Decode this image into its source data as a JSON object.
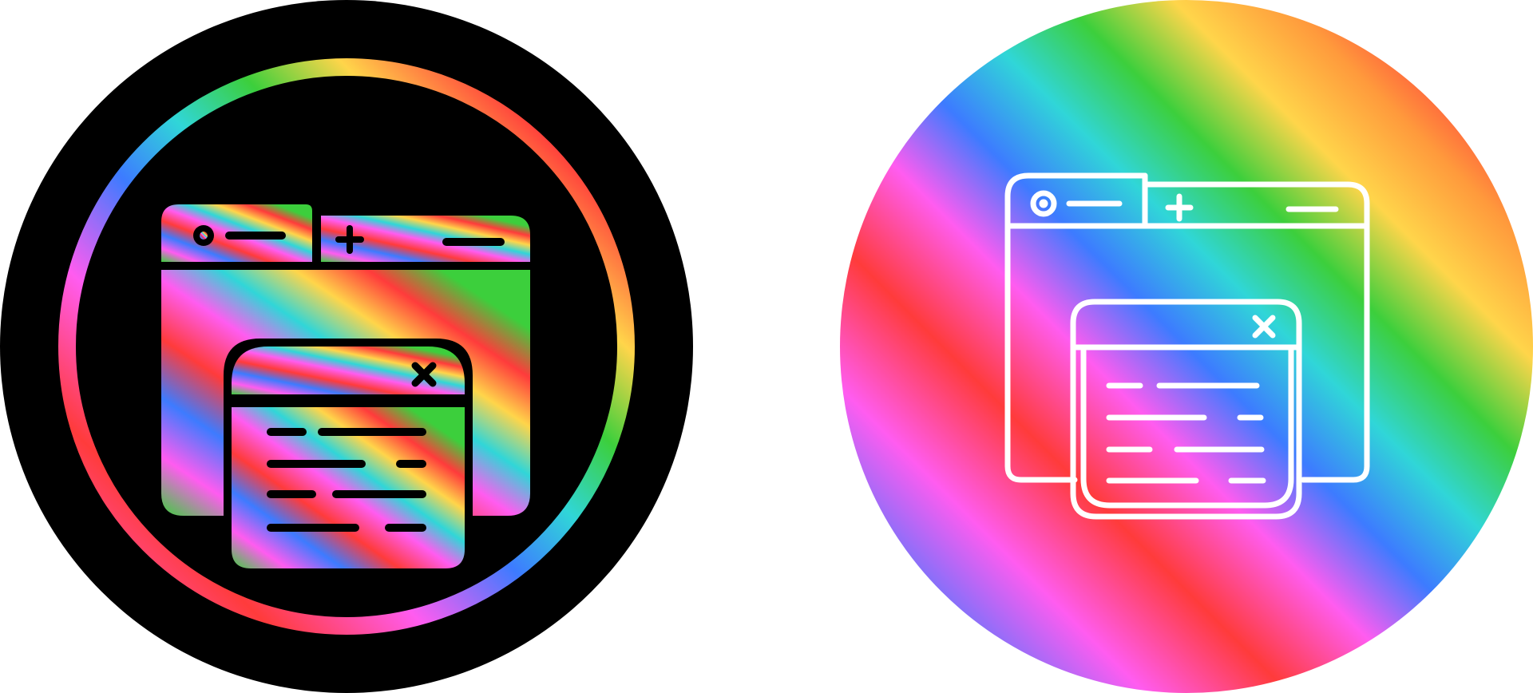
{
  "icons": [
    {
      "name": "browser-windows-glyph-icon",
      "style": "glyph on black badge with rainbow ring",
      "badge_color": "#000000"
    },
    {
      "name": "browser-windows-line-icon",
      "style": "white outline on rainbow badge",
      "stroke_color": "#ffffff"
    }
  ],
  "palette": {
    "black": "#000000",
    "white": "#ffffff",
    "red": "#ff3b3b",
    "orange": "#ff9a3c",
    "yellow": "#ffd54a",
    "green": "#3ccf3c",
    "cyan": "#30d6d8",
    "blue": "#3d7bff",
    "violet": "#a56cff",
    "magenta": "#ff5cf0"
  }
}
